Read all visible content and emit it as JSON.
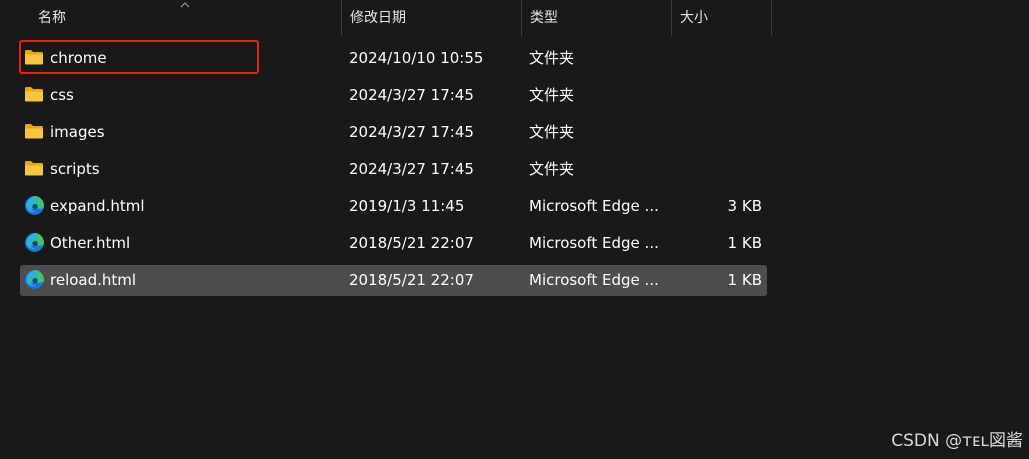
{
  "header": {
    "name": "名称",
    "date": "修改日期",
    "type": "类型",
    "size": "大小"
  },
  "files": [
    {
      "name": "chrome",
      "date": "2024/10/10 10:55",
      "type": "文件夹",
      "size": "",
      "icon": "folder-icon"
    },
    {
      "name": "css",
      "date": "2024/3/27 17:45",
      "type": "文件夹",
      "size": "",
      "icon": "folder-icon"
    },
    {
      "name": "images",
      "date": "2024/3/27 17:45",
      "type": "文件夹",
      "size": "",
      "icon": "folder-icon"
    },
    {
      "name": "scripts",
      "date": "2024/3/27 17:45",
      "type": "文件夹",
      "size": "",
      "icon": "folder-icon"
    },
    {
      "name": "expand.html",
      "date": "2019/1/3 11:45",
      "type": "Microsoft Edge ...",
      "size": "3 KB",
      "icon": "edge-icon"
    },
    {
      "name": "Other.html",
      "date": "2018/5/21 22:07",
      "type": "Microsoft Edge ...",
      "size": "1 KB",
      "icon": "edge-icon"
    },
    {
      "name": "reload.html",
      "date": "2018/5/21 22:07",
      "type": "Microsoft Edge ...",
      "size": "1 KB",
      "icon": "edge-icon"
    }
  ],
  "watermark": "CSDN @ᴛᴇʟ図酱",
  "colors": {
    "background": "#191919",
    "selected_row": "#4d4d4d",
    "highlight_box": "#e0241c",
    "folder": "#f8c542"
  }
}
